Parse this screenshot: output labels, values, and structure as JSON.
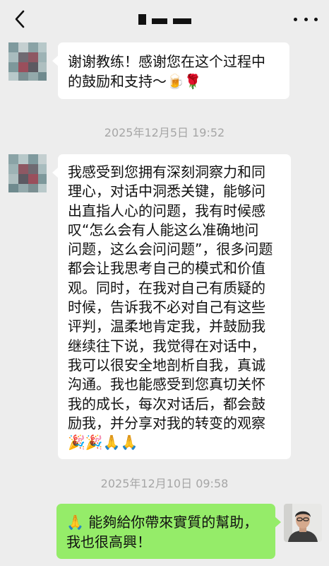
{
  "header": {
    "back_icon": "chevron-left-icon",
    "more_icon": "more-dots-icon"
  },
  "messages": [
    {
      "side": "left",
      "lines": [
        "谢谢教练！感谢您在这个过程中",
        "的鼓励和支持～🍺🌹"
      ]
    },
    {
      "timestamp": "2025年12月5日 19:52"
    },
    {
      "side": "left",
      "lines": [
        "我感受到您拥有深刻洞察力和同",
        "理心，对话中洞悉关键，能够问",
        "出直指人心的问题，我有时候感",
        "叹“怎么会有人能这么准确地问",
        "问题，这么会问问题”，很多问题",
        "都会让我思考自己的模式和价值",
        "观。同时，在我对自己有质疑的",
        "时候，告诉我不必对自己有这些",
        "评判，温柔地肯定我，并鼓励我",
        "继续往下说，我觉得在对话中，",
        "我可以很安全地剖析自我，真诚",
        "沟通。我也能感受到您真切关怀",
        "我的成长，每次对话后，都会鼓",
        "励我，并分享对我的转变的观察",
        "🎉🎉🙏🙏"
      ]
    },
    {
      "timestamp": "2025年12月10日 09:58"
    },
    {
      "side": "right",
      "lines": [
        "🙏 能夠給你帶來實質的幫助，",
        "我也很高興！"
      ]
    }
  ],
  "colors": {
    "background": "#ededed",
    "bubble_incoming": "#ffffff",
    "bubble_outgoing": "#95ec69",
    "timestamp_text": "#a6a6a6"
  }
}
